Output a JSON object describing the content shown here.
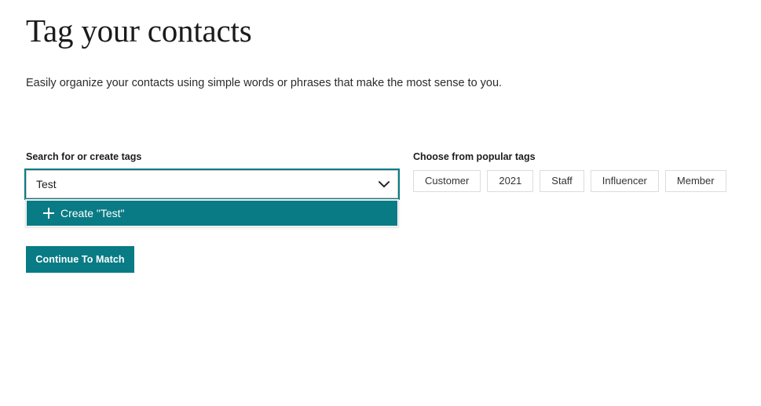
{
  "header": {
    "title": "Tag your contacts",
    "subtitle": "Easily organize your contacts using simple words or phrases that make the most sense to you."
  },
  "search": {
    "label": "Search for or create tags",
    "value": "Test",
    "placeholder": "",
    "chevron_icon": "chevron-down-icon",
    "dropdown": {
      "plus_icon": "plus-icon",
      "option_label": "Create \"Test\""
    }
  },
  "actions": {
    "continue_label": "Continue To Match"
  },
  "popular": {
    "label": "Choose from popular tags",
    "tags": [
      {
        "label": "Customer"
      },
      {
        "label": "2021"
      },
      {
        "label": "Staff"
      },
      {
        "label": "Influencer"
      },
      {
        "label": "Member"
      }
    ]
  },
  "colors": {
    "accent_teal": "#097b85",
    "text_primary": "#1c1c1c",
    "chip_border": "#dcdcdc",
    "input_border": "#c9c9c9",
    "focus_ring": "#0b7b85"
  }
}
